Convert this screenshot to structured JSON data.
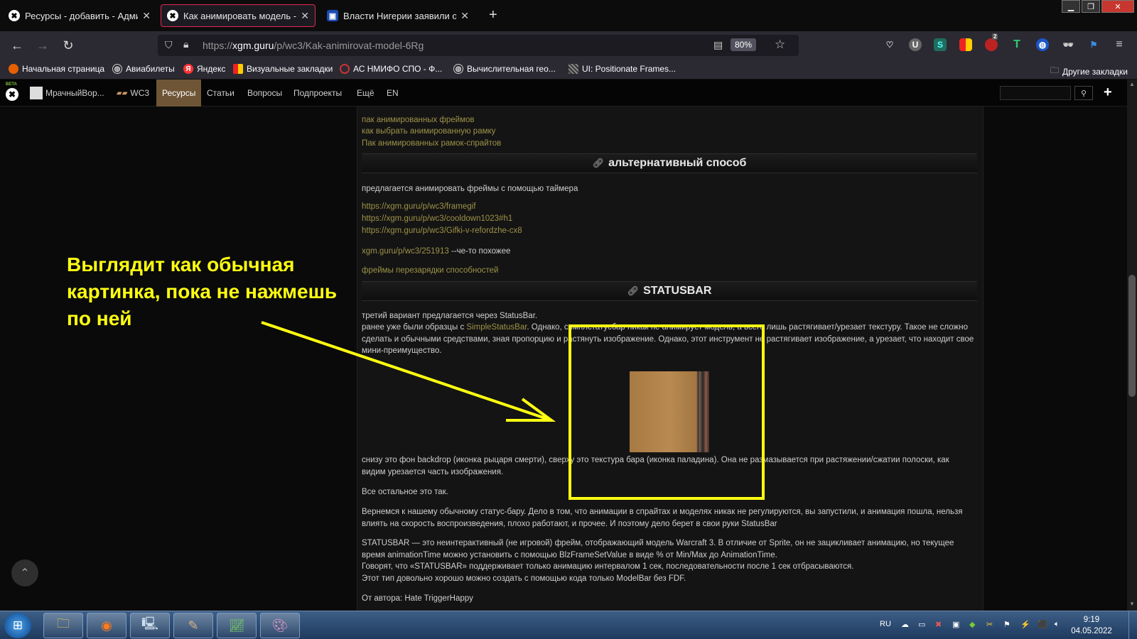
{
  "tabs": [
    {
      "title": "Ресурсы - добавить - Админи",
      "active": false,
      "icon": "xgm-icon"
    },
    {
      "title": "Как анимировать модель - Ста",
      "active": true,
      "icon": "xgm-icon"
    },
    {
      "title": "Власти Нигерии заявили о пл",
      "active": false,
      "icon": "news-icon"
    }
  ],
  "navbar": {
    "url_prefix": "https://",
    "url_host": "xgm.guru",
    "url_path": "/p/wc3/Kak-animirovat-model-6Rg",
    "zoom": "80%"
  },
  "extensions": {
    "badge_count": "2"
  },
  "bookmarks": [
    {
      "label": "Начальная страница",
      "icon": "firefox-icon"
    },
    {
      "label": "Авиабилеты",
      "icon": "globe-icon"
    },
    {
      "label": "Яндекс",
      "icon": "yandex-icon"
    },
    {
      "label": "Визуальные закладки",
      "icon": "bookmark-icon"
    },
    {
      "label": "АС НМИФО СПО - Ф...",
      "icon": "site-icon"
    },
    {
      "label": "Вычислительная гео...",
      "icon": "globe-icon"
    },
    {
      "label": "UI: Positionate Frames...",
      "icon": "site-icon"
    }
  ],
  "other_bookmarks": "Другие закладки",
  "sitenav": {
    "beta": "BETA",
    "user": "МрачныйВор...",
    "wc3": "WC3",
    "items": [
      "Ресурсы",
      "Статьи",
      "Вопросы",
      "Подпроекты",
      "Ещё",
      "EN"
    ]
  },
  "article": {
    "top_links": [
      "пак анимированных фреймов",
      "как выбрать анимированную рамку",
      "Пак анимированных рамок-спрайтов"
    ],
    "heading_alt": "альтернативный способ",
    "alt_intro": "предлагается анимировать фреймы с помощью таймера",
    "alt_links": [
      "https://xgm.guru/p/wc3/framegif",
      "https://xgm.guru/p/wc3/cooldown1023#h1",
      "https://xgm.guru/p/wc3/Gifki-v-refordzhe-cx8"
    ],
    "similar_link": "xgm.guru/p/wc3/251913",
    "similar_suffix": " --че-то похожее",
    "cooldown_link": "фреймы перезарядки способностей",
    "heading_statusbar": "STATUSBAR",
    "p1": "третий вариант предлагается через StatusBar.",
    "p2_before": "ранее уже были образцы с ",
    "p2_link": "SimpleStatusBar",
    "p2_after": ". Однако, симплстатусбар никак не анимирует модель, а всего лишь растягивает/урезает текстуру. Такое не сложно сделать и обычными средствами, зная пропорцию и растянуть изображение. Однако, этот инструмент не растягивает изображение, а урезает, что находит свое мини-преимущество.",
    "p3": "снизу это фон backdrop (иконка рыцаря смерти), сверху это текстура бара (иконка паладина). Она не размазывается при растяжении/сжатии полоски, как видим урезается часть изображения.",
    "p4": "Все остальное это так.",
    "p5": "Вернемся к нашему обычному статус-бару. Дело в том, что анимации в спрайтах и моделях никак не регулируются, вы запустили, и анимация пошла, нельзя влиять на скорость воспроизведения, плохо работают, и прочее. И поэтому дело берет в свои руки StatusBar",
    "p6a": "STATUSBAR — это неинтерактивный (не игровой) фрейм, отображающий модель Warcraft 3. В отличие от Sprite, он не зацикливает анимацию, но текущее время animationTime можно установить с помощью BlzFrameSetValue в виде % от Min/Max до AnimationTime.",
    "p6b": "Говорят, что «STATUSBAR» поддерживает только анимацию интервалом 1 сек, последовательности после 1 сек отбрасываются.",
    "p6c": "Этот тип довольно хорошо можно создать с помощью кода только ModelBar без FDF.",
    "p7": "От автора: Hate TriggerHappy"
  },
  "annotation": {
    "text": "Выглядит как обычная картинка, пока не нажмешь по ней",
    "color": "#ffff12"
  },
  "taskbar": {
    "lang": "RU",
    "time": "9:19",
    "date": "04.05.2022"
  }
}
